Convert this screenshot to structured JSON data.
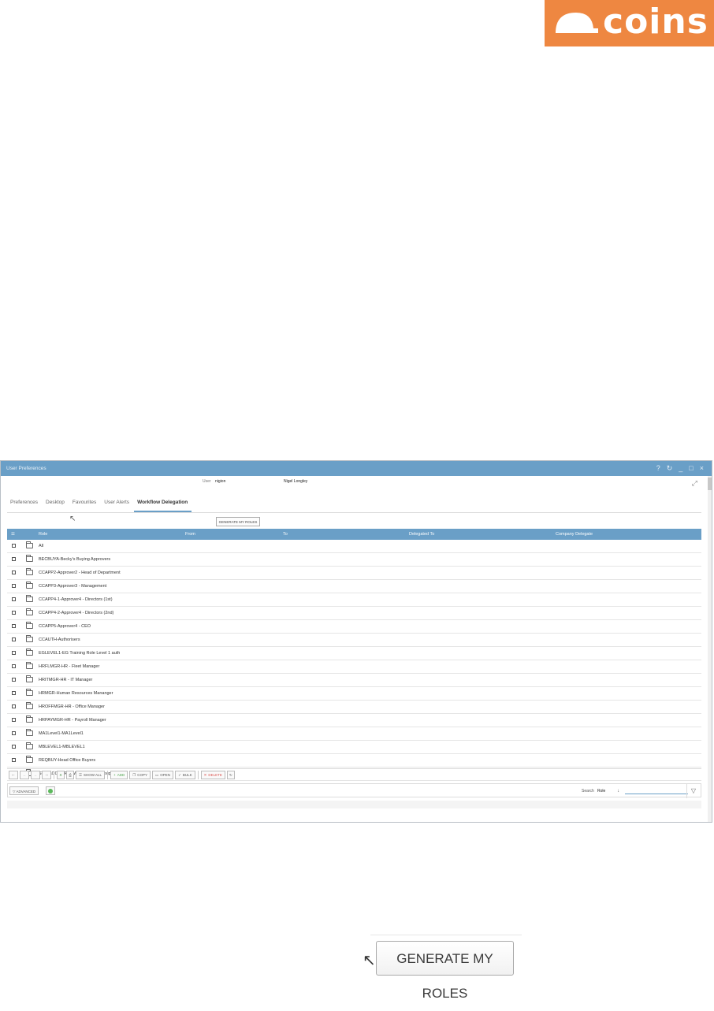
{
  "brand": {
    "name": "coins",
    "color": "#ee8741"
  },
  "window": {
    "title": "User Preferences",
    "controls": [
      "?",
      "↻",
      "_",
      "□",
      "×"
    ]
  },
  "user": {
    "label": "User",
    "id": "nigion",
    "name": "Nigel Longley"
  },
  "tabs": [
    {
      "label": "Preferences",
      "active": false
    },
    {
      "label": "Desktop",
      "active": false
    },
    {
      "label": "Favourites",
      "active": false
    },
    {
      "label": "User Alerts",
      "active": false
    },
    {
      "label": "Workflow Delegation",
      "active": true
    }
  ],
  "generate_button": "GENERATE MY ROLES",
  "grid": {
    "columns": [
      "Role",
      "From",
      "To",
      "Delegated To",
      "Company Delegate"
    ],
    "rows": [
      "All",
      "BECBUYA-Becky's Buying Approvers",
      "CCAPP2-Approver2 - Head of Department",
      "CCAPP3-Approver3 - Management",
      "CCAPP4-1-Approver4 - Directors (1st)",
      "CCAPP4-2-Approver4 - Directors (2nd)",
      "CCAPP5-Approver4 - CEO",
      "CCAUTH-Authorisers",
      "EGLEVEL1-EG Training Role Level 1 auth",
      "HRFLMGR-HR - Fleet Manager",
      "HRITMGR-HR - IT Manager",
      "HRMGR-Human Resources Mananger",
      "HROFFMGR-HR - Office Manager",
      "HRPAYMGR-HR - Payroll Manager",
      "MA1Level1-MA1Level1",
      "MBLEVEL1-MBLEVEL1",
      "REQBUY-Head Office Buyers",
      "SWHACCGRP-SWH Accounts Group"
    ]
  },
  "toolbar": {
    "show_all": "SHOW ALL",
    "add": "ADD",
    "copy": "COPY",
    "open": "OPEN",
    "bulk": "BULK",
    "delete": "DELETE"
  },
  "filter": {
    "advanced": "ADVANCED",
    "search_label": "Search",
    "search_field": "Role",
    "search_value": ""
  }
}
